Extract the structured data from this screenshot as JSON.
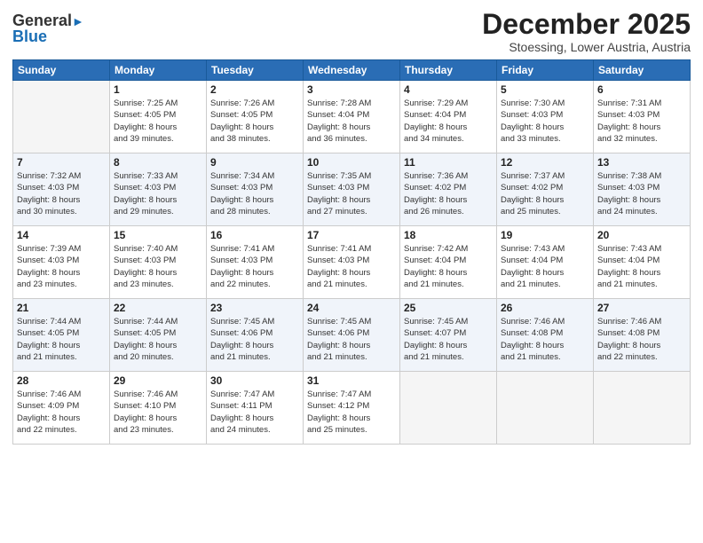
{
  "header": {
    "logo": {
      "general": "General",
      "blue": "Blue"
    },
    "month": "December 2025",
    "location": "Stoessing, Lower Austria, Austria"
  },
  "weekdays": [
    "Sunday",
    "Monday",
    "Tuesday",
    "Wednesday",
    "Thursday",
    "Friday",
    "Saturday"
  ],
  "weeks": [
    [
      {
        "day": "",
        "info": ""
      },
      {
        "day": "1",
        "info": "Sunrise: 7:25 AM\nSunset: 4:05 PM\nDaylight: 8 hours\nand 39 minutes."
      },
      {
        "day": "2",
        "info": "Sunrise: 7:26 AM\nSunset: 4:05 PM\nDaylight: 8 hours\nand 38 minutes."
      },
      {
        "day": "3",
        "info": "Sunrise: 7:28 AM\nSunset: 4:04 PM\nDaylight: 8 hours\nand 36 minutes."
      },
      {
        "day": "4",
        "info": "Sunrise: 7:29 AM\nSunset: 4:04 PM\nDaylight: 8 hours\nand 34 minutes."
      },
      {
        "day": "5",
        "info": "Sunrise: 7:30 AM\nSunset: 4:03 PM\nDaylight: 8 hours\nand 33 minutes."
      },
      {
        "day": "6",
        "info": "Sunrise: 7:31 AM\nSunset: 4:03 PM\nDaylight: 8 hours\nand 32 minutes."
      }
    ],
    [
      {
        "day": "7",
        "info": "Sunrise: 7:32 AM\nSunset: 4:03 PM\nDaylight: 8 hours\nand 30 minutes."
      },
      {
        "day": "8",
        "info": "Sunrise: 7:33 AM\nSunset: 4:03 PM\nDaylight: 8 hours\nand 29 minutes."
      },
      {
        "day": "9",
        "info": "Sunrise: 7:34 AM\nSunset: 4:03 PM\nDaylight: 8 hours\nand 28 minutes."
      },
      {
        "day": "10",
        "info": "Sunrise: 7:35 AM\nSunset: 4:03 PM\nDaylight: 8 hours\nand 27 minutes."
      },
      {
        "day": "11",
        "info": "Sunrise: 7:36 AM\nSunset: 4:02 PM\nDaylight: 8 hours\nand 26 minutes."
      },
      {
        "day": "12",
        "info": "Sunrise: 7:37 AM\nSunset: 4:02 PM\nDaylight: 8 hours\nand 25 minutes."
      },
      {
        "day": "13",
        "info": "Sunrise: 7:38 AM\nSunset: 4:03 PM\nDaylight: 8 hours\nand 24 minutes."
      }
    ],
    [
      {
        "day": "14",
        "info": "Sunrise: 7:39 AM\nSunset: 4:03 PM\nDaylight: 8 hours\nand 23 minutes."
      },
      {
        "day": "15",
        "info": "Sunrise: 7:40 AM\nSunset: 4:03 PM\nDaylight: 8 hours\nand 23 minutes."
      },
      {
        "day": "16",
        "info": "Sunrise: 7:41 AM\nSunset: 4:03 PM\nDaylight: 8 hours\nand 22 minutes."
      },
      {
        "day": "17",
        "info": "Sunrise: 7:41 AM\nSunset: 4:03 PM\nDaylight: 8 hours\nand 21 minutes."
      },
      {
        "day": "18",
        "info": "Sunrise: 7:42 AM\nSunset: 4:04 PM\nDaylight: 8 hours\nand 21 minutes."
      },
      {
        "day": "19",
        "info": "Sunrise: 7:43 AM\nSunset: 4:04 PM\nDaylight: 8 hours\nand 21 minutes."
      },
      {
        "day": "20",
        "info": "Sunrise: 7:43 AM\nSunset: 4:04 PM\nDaylight: 8 hours\nand 21 minutes."
      }
    ],
    [
      {
        "day": "21",
        "info": "Sunrise: 7:44 AM\nSunset: 4:05 PM\nDaylight: 8 hours\nand 21 minutes."
      },
      {
        "day": "22",
        "info": "Sunrise: 7:44 AM\nSunset: 4:05 PM\nDaylight: 8 hours\nand 20 minutes."
      },
      {
        "day": "23",
        "info": "Sunrise: 7:45 AM\nSunset: 4:06 PM\nDaylight: 8 hours\nand 21 minutes."
      },
      {
        "day": "24",
        "info": "Sunrise: 7:45 AM\nSunset: 4:06 PM\nDaylight: 8 hours\nand 21 minutes."
      },
      {
        "day": "25",
        "info": "Sunrise: 7:45 AM\nSunset: 4:07 PM\nDaylight: 8 hours\nand 21 minutes."
      },
      {
        "day": "26",
        "info": "Sunrise: 7:46 AM\nSunset: 4:08 PM\nDaylight: 8 hours\nand 21 minutes."
      },
      {
        "day": "27",
        "info": "Sunrise: 7:46 AM\nSunset: 4:08 PM\nDaylight: 8 hours\nand 22 minutes."
      }
    ],
    [
      {
        "day": "28",
        "info": "Sunrise: 7:46 AM\nSunset: 4:09 PM\nDaylight: 8 hours\nand 22 minutes."
      },
      {
        "day": "29",
        "info": "Sunrise: 7:46 AM\nSunset: 4:10 PM\nDaylight: 8 hours\nand 23 minutes."
      },
      {
        "day": "30",
        "info": "Sunrise: 7:47 AM\nSunset: 4:11 PM\nDaylight: 8 hours\nand 24 minutes."
      },
      {
        "day": "31",
        "info": "Sunrise: 7:47 AM\nSunset: 4:12 PM\nDaylight: 8 hours\nand 25 minutes."
      },
      {
        "day": "",
        "info": ""
      },
      {
        "day": "",
        "info": ""
      },
      {
        "day": "",
        "info": ""
      }
    ]
  ]
}
